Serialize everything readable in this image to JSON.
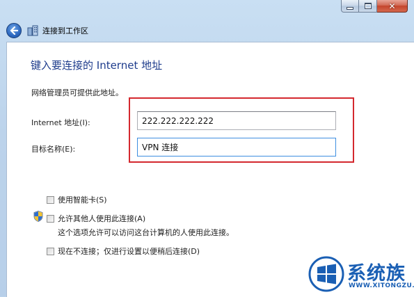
{
  "nav": {
    "title": "连接到工作区"
  },
  "page": {
    "heading": "键入要连接的 Internet 地址",
    "admin_note": "网络管理员可提供此地址。"
  },
  "form": {
    "address_label": "Internet 地址(I):",
    "address_value": "222.222.222.222",
    "name_label": "目标名称(E):",
    "name_value": "VPN 连接"
  },
  "options": {
    "smart_card": "使用智能卡(S)",
    "allow_others": "允许其他人使用此连接(A)",
    "allow_others_desc": "这个选项允许可以访问这台计算机的人使用此连接。",
    "connect_later": "现在不连接；仅进行设置以便稍后连接(D)"
  },
  "watermark": {
    "brand": "系统族",
    "url": "WWW.XITONGZU.COM"
  },
  "colors": {
    "heading": "#1e3c8c",
    "highlight": "#d4282e",
    "watermark": "#1a5fb4"
  }
}
